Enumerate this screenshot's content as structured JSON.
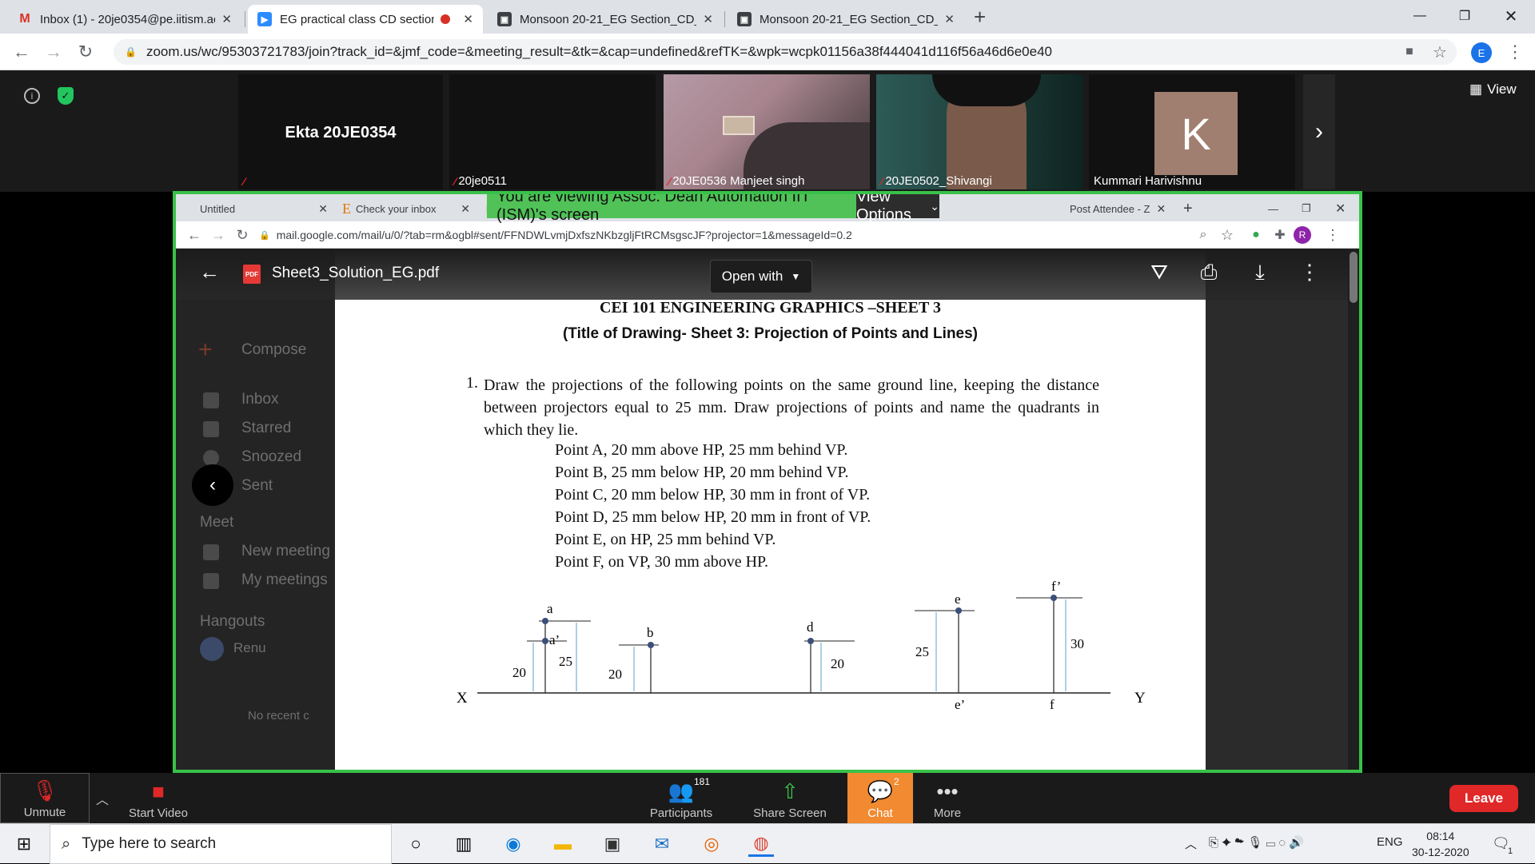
{
  "browser": {
    "tabs": [
      {
        "title": "Inbox (1) - 20je0354@pe.iitism.ac",
        "favicon": "gmail-icon"
      },
      {
        "title": "EG practical class CD section",
        "favicon": "zoom-icon"
      },
      {
        "title": "Monsoon 20-21_EG Section_CD_",
        "favicon": "classroom-icon"
      },
      {
        "title": "Monsoon 20-21_EG Section_CD_",
        "favicon": "classroom-icon"
      }
    ],
    "url": "zoom.us/wc/95303721783/join?track_id=&jmf_code=&meeting_result=&tk=&cap=undefined&refTK=&wpk=wcpk01156a38f444041d116f56a46d6e0e40",
    "profile_initial": "E"
  },
  "zoom": {
    "view_label": "View",
    "participants_tiles": [
      {
        "name": "Ekta 20JE0354",
        "muted": true,
        "video": false
      },
      {
        "name": "20je0511",
        "muted": true,
        "video": false
      },
      {
        "name": "20JE0536 Manjeet singh",
        "muted": true,
        "video": true
      },
      {
        "name": "20JE0502_Shivangi",
        "muted": true,
        "video": true
      },
      {
        "name": "Kummari Harivishnu",
        "muted": false,
        "video": false,
        "avatar_letter": "K"
      }
    ],
    "banner": "You are viewing Assoc. Dean Automation IIT (ISM)'s screen",
    "view_options": "View Options",
    "toolbar": {
      "unmute": "Unmute",
      "start_video": "Start Video",
      "participants": "Participants",
      "participants_count": "181",
      "share_screen": "Share Screen",
      "chat": "Chat",
      "chat_badge": "2",
      "more": "More",
      "leave": "Leave"
    }
  },
  "shared": {
    "tabs": [
      "Untitled",
      "Check your inbox",
      "Post Attendee - Z"
    ],
    "url": "mail.google.com/mail/u/0/?tab=rm&ogbl#sent/FFNDWLvmjDxfszNKbzgljFtRCMsgscJF?projector=1&messageId=0.2",
    "profile_initial": "R",
    "pdf_name": "Sheet3_Solution_EG.pdf",
    "open_with": "Open with",
    "gmail": {
      "compose": "Compose",
      "items": [
        "Inbox",
        "Starred",
        "Snoozed",
        "Sent"
      ],
      "meet_header": "Meet",
      "meet_items": [
        "New meeting",
        "My meetings"
      ],
      "hangouts_header": "Hangouts",
      "hangouts_user": "Renu",
      "no_recent": "No recent c"
    },
    "document": {
      "title": "CEI 101 ENGINEERING GRAPHICS –SHEET 3",
      "subtitle": "(Title of Drawing- Sheet 3: Projection of Points and Lines)",
      "q1_number": "1.",
      "q1_text": "Draw the projections of the following points on the same ground line, keeping the distance between projectors equal to 25 mm. Draw projections of points and name the quadrants in which they lie.",
      "points": [
        "Point A, 20 mm above HP, 25 mm behind VP.",
        "Point B, 25 mm below HP, 20 mm behind VP.",
        "Point C, 20 mm below HP, 30 mm in front of VP.",
        "Point D, 25 mm below HP, 20 mm in front of VP.",
        "Point E, on HP, 25 mm behind VP.",
        "Point F, on VP, 30 mm above HP."
      ],
      "drawing_labels": {
        "x": "X",
        "y": "Y",
        "a": "a",
        "a_prime": "a’",
        "b": "b",
        "d": "d",
        "e": "e",
        "e_prime": "e’",
        "f": "f",
        "f_prime": "f’",
        "dim_a_20": "20",
        "dim_a_25": "25",
        "dim_b_20": "20",
        "dim_d_20": "20",
        "dim_e_25": "25",
        "dim_f_30": "30"
      }
    }
  },
  "taskbar": {
    "search_placeholder": "Type here to search",
    "language": "ENG",
    "time": "08:14",
    "date": "30-12-2020",
    "notification_count": "1"
  }
}
